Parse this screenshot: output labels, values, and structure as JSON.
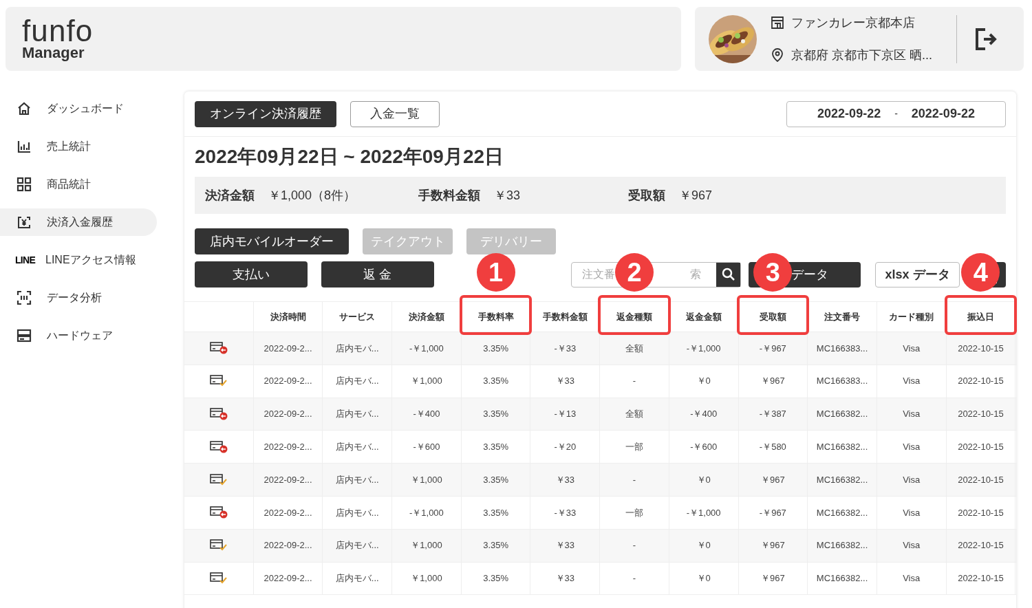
{
  "logo": {
    "wordmark": "funfo",
    "subtitle": "Manager"
  },
  "store": {
    "name": "ファンカレー京都本店",
    "address": "京都府 京都市下京区 晒..."
  },
  "sidebar": {
    "items": [
      {
        "kind": "home",
        "label": "ダッシュボード",
        "selected": false
      },
      {
        "kind": "chart",
        "label": "売上統計",
        "selected": false
      },
      {
        "kind": "grid",
        "label": "商品統計",
        "selected": false
      },
      {
        "kind": "yen",
        "label": "決済入金履歴",
        "selected": true
      },
      {
        "kind": "line",
        "icon_text": "LINE",
        "label": "LINEアクセス情報",
        "selected": false
      },
      {
        "kind": "scan",
        "label": "データ分析",
        "selected": false
      },
      {
        "kind": "hardware",
        "label": "ハードウェア",
        "selected": false
      }
    ]
  },
  "tabs": [
    {
      "label": "オンライン決済履歴",
      "selected": true
    },
    {
      "label": "入金一覧",
      "selected": false
    }
  ],
  "date_range": {
    "start": "2022-09-22",
    "separator": "-",
    "end": "2022-09-22"
  },
  "heading": "2022年09月22日 ~ 2022年09月22日",
  "summary": [
    {
      "label": "決済金額",
      "value": "￥1,000（8件）"
    },
    {
      "label": "手数料金額",
      "value": "￥33"
    },
    {
      "label": "受取額",
      "value": "￥967"
    }
  ],
  "service_filters": [
    {
      "label": "店内モバイルオーダー",
      "selected": true
    },
    {
      "label": "テイクアウト",
      "selected": false
    },
    {
      "label": "デリバリー",
      "selected": false
    }
  ],
  "type_filters": [
    {
      "label": "支払い",
      "selected": true
    },
    {
      "label": "返 金",
      "selected": true
    }
  ],
  "search": {
    "placeholder": "注文番",
    "placeholder_tail": "索"
  },
  "exports": [
    {
      "kind": "dark",
      "label": "データ"
    },
    {
      "kind": "outline",
      "label": "xlsx データ"
    },
    {
      "kind": "icon"
    }
  ],
  "table": {
    "columns": [
      {
        "label": "決済時間"
      },
      {
        "label": "サービス"
      },
      {
        "label": "決済金額"
      },
      {
        "label": "手数料率",
        "callout": "1"
      },
      {
        "label": "手数料金額"
      },
      {
        "label": "返金種類",
        "callout": "2"
      },
      {
        "label": "返金金額"
      },
      {
        "label": "受取額",
        "callout": "3"
      },
      {
        "label": "注文番号"
      },
      {
        "label": "カード種別"
      },
      {
        "label": "振込日",
        "callout": "4"
      }
    ],
    "rows": [
      {
        "kind": "refund",
        "cells": [
          "2022-09-2...",
          "店内モバ...",
          "-￥1,000",
          "3.35%",
          "-￥33",
          "全額",
          "-￥1,000",
          "-￥967",
          "MC166383...",
          "Visa",
          "2022-10-15"
        ]
      },
      {
        "kind": "payment",
        "cells": [
          "2022-09-2...",
          "店内モバ...",
          "￥1,000",
          "3.35%",
          "￥33",
          "-",
          "￥0",
          "￥967",
          "MC166383...",
          "Visa",
          "2022-10-15"
        ]
      },
      {
        "kind": "refund",
        "cells": [
          "2022-09-2...",
          "店内モバ...",
          "-￥400",
          "3.35%",
          "-￥13",
          "全額",
          "-￥400",
          "-￥387",
          "MC166382...",
          "Visa",
          "2022-10-15"
        ]
      },
      {
        "kind": "refund",
        "cells": [
          "2022-09-2...",
          "店内モバ...",
          "-￥600",
          "3.35%",
          "-￥20",
          "一部",
          "-￥600",
          "-￥580",
          "MC166382...",
          "Visa",
          "2022-10-15"
        ]
      },
      {
        "kind": "payment",
        "cells": [
          "2022-09-2...",
          "店内モバ...",
          "￥1,000",
          "3.35%",
          "￥33",
          "-",
          "￥0",
          "￥967",
          "MC166382...",
          "Visa",
          "2022-10-15"
        ]
      },
      {
        "kind": "refund",
        "cells": [
          "2022-09-2...",
          "店内モバ...",
          "-￥1,000",
          "3.35%",
          "-￥33",
          "一部",
          "-￥1,000",
          "-￥967",
          "MC166382...",
          "Visa",
          "2022-10-15"
        ]
      },
      {
        "kind": "payment",
        "cells": [
          "2022-09-2...",
          "店内モバ...",
          "￥1,000",
          "3.35%",
          "￥33",
          "-",
          "￥0",
          "￥967",
          "MC166382...",
          "Visa",
          "2022-10-15"
        ]
      },
      {
        "kind": "payment",
        "cells": [
          "2022-09-2...",
          "店内モバ...",
          "￥1,000",
          "3.35%",
          "￥33",
          "-",
          "￥0",
          "￥967",
          "MC166382...",
          "Visa",
          "2022-10-15"
        ]
      }
    ]
  }
}
